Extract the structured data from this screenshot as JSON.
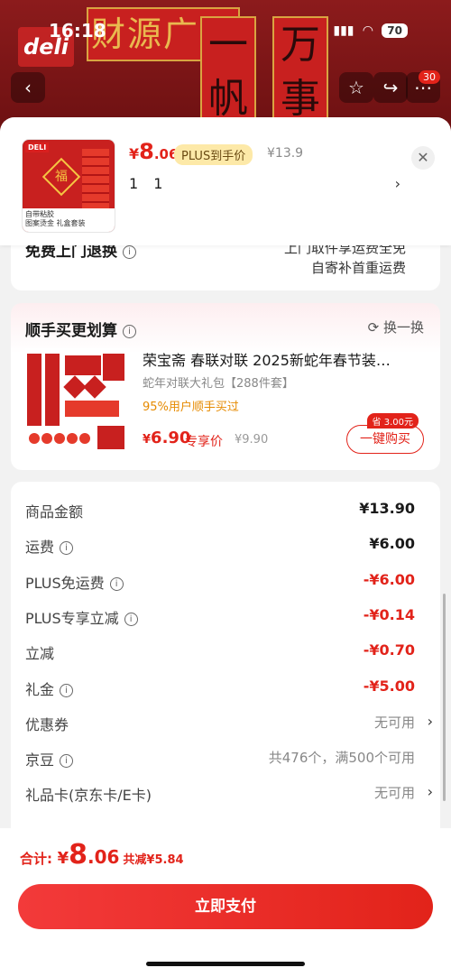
{
  "status": {
    "time": "16:18",
    "battery": "70"
  },
  "background": {
    "brand": "deli",
    "banner_text": "财源广进",
    "couplet_chars": [
      "一",
      "帆",
      "万",
      "事"
    ],
    "cart_count": "30"
  },
  "sheet": {
    "price": {
      "yen": "¥",
      "int": "8",
      "dec": ".06"
    },
    "plus_tag": "PLUS到手价",
    "orig_price": "¥13.9",
    "spec": "1 1",
    "thumb": {
      "tag": "DELI",
      "fu": "福",
      "foot1": "自带粘胶",
      "foot2": "图案烫金 礼盒套装"
    }
  },
  "shipping": {
    "label": "免费上门退换",
    "line1": "上门取件享运费全免",
    "line2": "自寄补首重运费"
  },
  "addon": {
    "title": "顺手买更划算",
    "swap": "换一换",
    "name": "荣宝斋 春联对联 2025新蛇年春节装…",
    "sub": "蛇年对联大礼包【288件套】",
    "rate": "95%用户顺手买过",
    "price_yen": "¥",
    "price_val": "6.90",
    "price_label": "专享价",
    "orig": "¥9.90",
    "save": "省 3.00元",
    "buy": "一键购买"
  },
  "summary": [
    {
      "k": "商品金额",
      "v": "¥13.90",
      "style": "",
      "info": false,
      "chev": false
    },
    {
      "k": "运费",
      "v": "¥6.00",
      "style": "",
      "info": true,
      "chev": false
    },
    {
      "k": "PLUS免运费",
      "v": "-¥6.00",
      "style": "red",
      "info": true,
      "chev": false
    },
    {
      "k": "PLUS专享立减",
      "v": "-¥0.14",
      "style": "red",
      "info": true,
      "chev": false
    },
    {
      "k": "立减",
      "v": "-¥0.70",
      "style": "red",
      "info": false,
      "chev": false
    },
    {
      "k": "礼金",
      "v": "-¥5.00",
      "style": "red",
      "info": true,
      "chev": false
    },
    {
      "k": "优惠券",
      "v": "无可用",
      "style": "gray",
      "info": false,
      "chev": true
    },
    {
      "k": "京豆",
      "v": "共476个，满500个可用",
      "style": "gray",
      "info": true,
      "chev": false
    },
    {
      "k": "礼品卡(京东卡/E卡)",
      "v": "无可用",
      "style": "gray",
      "info": false,
      "chev": true
    }
  ],
  "footer": {
    "label": "合计:",
    "yen": "¥",
    "int": "8",
    "dec": ".06",
    "save": "共减¥5.84",
    "pay": "立即支付"
  },
  "icons": {
    "info": "i",
    "chevron": "›",
    "close": "✕",
    "back": "‹"
  }
}
